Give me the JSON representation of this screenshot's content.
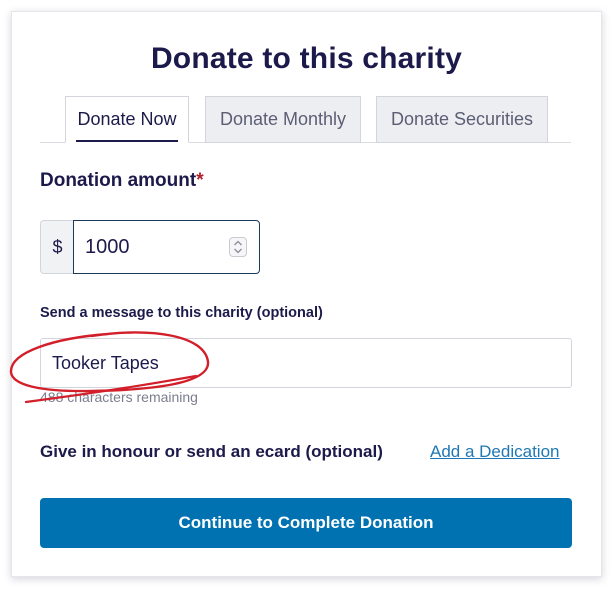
{
  "title": "Donate to this charity",
  "tabs": [
    {
      "label": "Donate Now",
      "active": true
    },
    {
      "label": "Donate Monthly",
      "active": false
    },
    {
      "label": "Donate Securities",
      "active": false
    }
  ],
  "amount": {
    "label": "Donation amount",
    "required_mark": "*",
    "currency": "$",
    "value": "1000"
  },
  "message": {
    "label": "Send a message to this charity (optional)",
    "value": "Tooker Tapes",
    "remaining_text": "488 characters remaining"
  },
  "dedication": {
    "label": "Give in honour or send an ecard (optional)",
    "link": "Add a Dedication"
  },
  "continue_button": "Continue to Complete Donation",
  "colors": {
    "primary": "#0072b1",
    "heading": "#1c1a4a",
    "link": "#1f78b4",
    "annotation": "#d21f2a"
  }
}
